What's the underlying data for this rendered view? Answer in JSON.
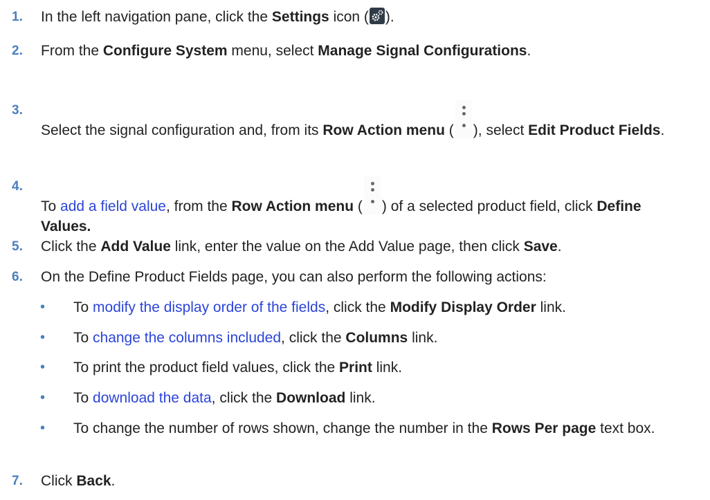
{
  "steps": [
    {
      "num": "1.",
      "pre": "In the left navigation pane, click the ",
      "b1": "Settings",
      "mid": " icon (",
      "icon": "gear-settings-icon",
      "post": ")."
    },
    {
      "num": "2.",
      "pre": "From the ",
      "b1": "Configure System",
      "mid": " menu, select ",
      "b2": "Manage Signal Configurations",
      "post": "."
    },
    {
      "num": "3.",
      "pre": "Select the signal configuration and, from its ",
      "b1": "Row Action menu",
      "mid": " (",
      "icon": "kebab-menu-icon",
      "mid2": "), select ",
      "b2": "Edit Product Fields",
      "post": "."
    },
    {
      "num": "4.",
      "pre": "To ",
      "link": "add a field value",
      "mid": ", from the ",
      "b1": "Row Action menu",
      "mid2": " (",
      "icon": "kebab-menu-icon",
      "mid3": ") of a selected product field, click ",
      "b2": "Define Values."
    },
    {
      "num": "5.",
      "pre": "Click the ",
      "b1": "Add Value",
      "mid": " link, enter the value on the Add Value page, then click ",
      "b2": "Save",
      "post": "."
    },
    {
      "num": "6.",
      "text": "On the Define Product Fields page, you can also perform the following actions:"
    },
    {
      "num": "7.",
      "pre": "Click ",
      "b1": "Back",
      "post": "."
    }
  ],
  "bullets": [
    {
      "pre": "To ",
      "link": "modify the display order of the fields",
      "mid": ", click the ",
      "b1": "Modify Display Order",
      "post": " link."
    },
    {
      "pre": "To ",
      "link": "change the columns included",
      "mid": ", click the ",
      "b1": "Columns",
      "post": " link."
    },
    {
      "pre": "To print the product field values, click the ",
      "b1": "Print",
      "post": " link."
    },
    {
      "pre": "To ",
      "link": "download the data",
      "mid": ", click the ",
      "b1": "Download",
      "post": " link."
    },
    {
      "pre": "To change the number of rows shown, change the number in the ",
      "b1": "Rows Per page",
      "post": " text box."
    }
  ],
  "bullet_glyph": "•",
  "colors": {
    "step_number": "#4a7fbd",
    "link": "#2b45d8",
    "text": "#222222"
  }
}
